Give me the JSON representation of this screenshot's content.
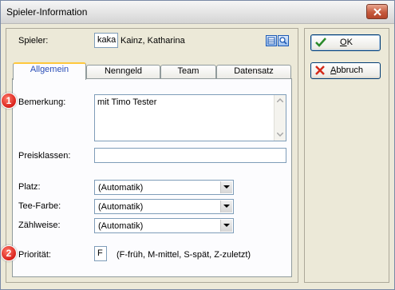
{
  "window": {
    "title": "Spieler-Information"
  },
  "player": {
    "label": "Spieler:",
    "code": "kaka",
    "name": "Kainz, Katharina"
  },
  "tabs": [
    {
      "label": "Allgemein"
    },
    {
      "label": "Nenngeld"
    },
    {
      "label": "Team"
    },
    {
      "label": "Datensatz"
    }
  ],
  "general": {
    "remark_label": "Bemerkung:",
    "remark_value": "mit Timo Tester",
    "price_classes_label": "Preisklassen:",
    "price_classes_value": "",
    "place_label": "Platz:",
    "place_value": "(Automatik)",
    "tee_color_label": "Tee-Farbe:",
    "tee_color_value": "(Automatik)",
    "counting_label": "Zählweise:",
    "counting_value": "(Automatik)",
    "priority_label": "Priorität:",
    "priority_value": "F",
    "priority_hint": "(F-früh, M-mittel, S-spät, Z-zuletzt)"
  },
  "badges": {
    "one": "1",
    "two": "2"
  },
  "buttons": {
    "ok": "OK",
    "ok_first": "O",
    "ok_rest": "K",
    "cancel_first": "A",
    "cancel_rest": "bbruch"
  },
  "colors": {
    "ok_check": "#2a8a2a",
    "cancel_x": "#d42a1a",
    "active_tab_text": "#2b4eb7",
    "badge": "#d9201a"
  },
  "icons": {
    "close": "close-icon",
    "ok": "check-icon",
    "cancel": "x-icon",
    "lookup": "table-icon",
    "search": "search-icon"
  }
}
